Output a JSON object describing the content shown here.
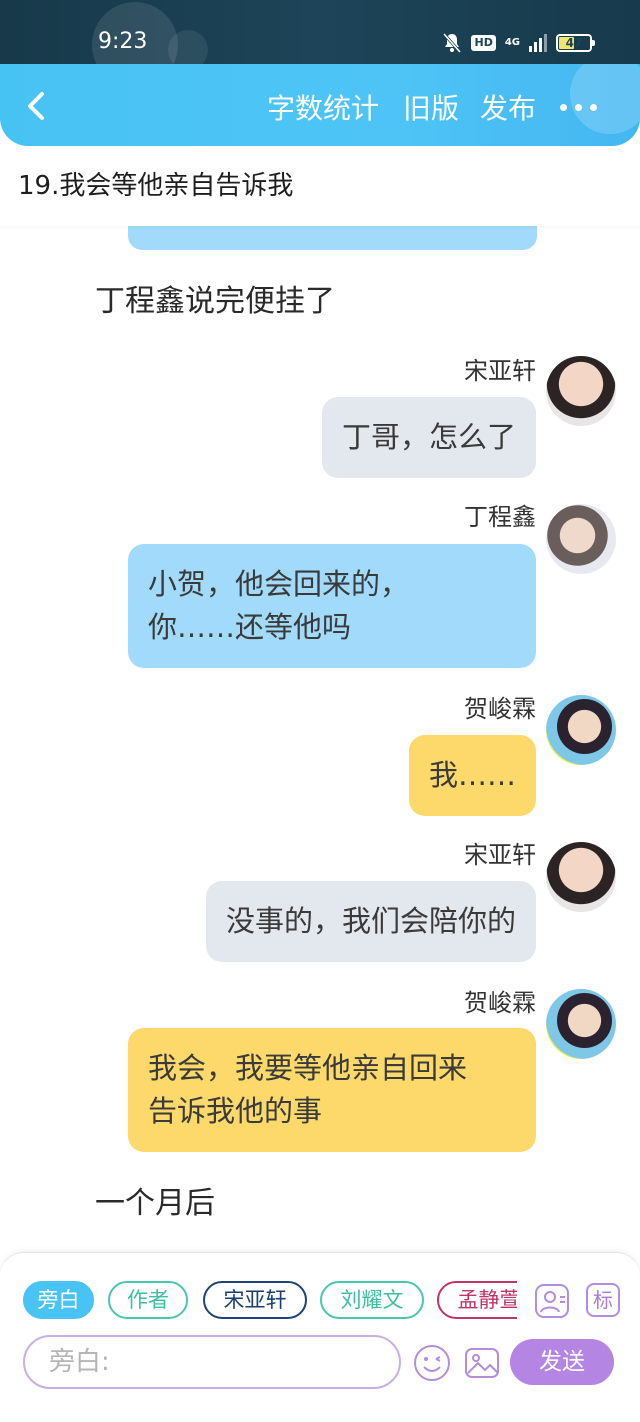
{
  "status_bar": {
    "time": "9:23",
    "hd": "HD",
    "network": "4G",
    "battery": "47",
    "battery_level": 0.47
  },
  "header": {
    "word_count": "字数统计",
    "old_version": "旧版",
    "publish": "发布",
    "back_icon": "chevron-left-icon",
    "more_icon": "more-horizontal-icon",
    "accent": "#4ec4f6"
  },
  "chapter": {
    "title": "19.我会等他亲自告诉我"
  },
  "chat": {
    "narration_1": "丁程鑫说完便挂了",
    "messages": [
      {
        "speaker": "宋亚轩",
        "text": "丁哥，怎么了",
        "color": "#e3e7ee"
      },
      {
        "speaker": "丁程鑫",
        "text_line1": "小贺，他会回来的，",
        "text_line2": "你……还等他吗",
        "color": "#a2dafb"
      },
      {
        "speaker": "贺峻霖",
        "text": "我……",
        "color": "#fcd96a"
      },
      {
        "speaker": "宋亚轩",
        "text": "没事的，我们会陪你的",
        "color": "#e3e7ee"
      },
      {
        "speaker": "贺峻霖",
        "text_line1": "我会，我要等他亲自回来",
        "text_line2": "告诉我他的事",
        "color": "#fcd96a"
      }
    ],
    "narration_2": "一个月后"
  },
  "composer": {
    "chips": [
      "旁白",
      "作者",
      "宋亚轩",
      "刘耀文",
      "孟静萱"
    ],
    "tag_label": "标",
    "input_placeholder": "旁白:",
    "send": "发送",
    "send_color": "#b485e2"
  }
}
